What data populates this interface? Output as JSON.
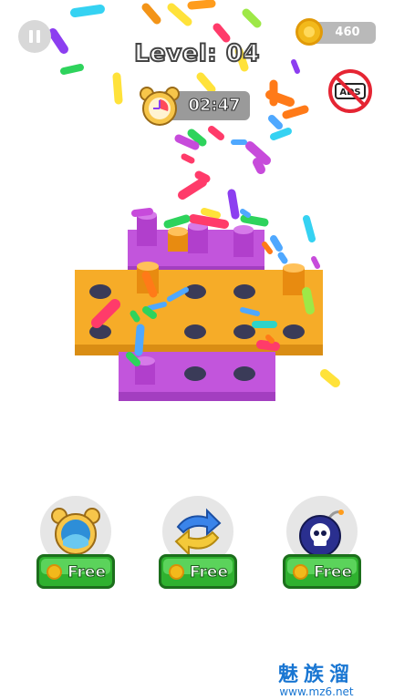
{
  "hud": {
    "coins": "460",
    "level_label": "Level: 04",
    "timer": "02:47",
    "ads_label": "ADS"
  },
  "boosters": [
    {
      "icon": "alarm-clock-icon",
      "label": "Free"
    },
    {
      "icon": "swap-arrows-icon",
      "label": "Free"
    },
    {
      "icon": "skull-bomb-icon",
      "label": "Free"
    }
  ],
  "watermark": {
    "brand": "魅族溜",
    "url": "www.mz6.net"
  },
  "colors": {
    "orange_tile": "#f6ac28",
    "purple_tile": "#c255dc",
    "green_button": "#2fb12f",
    "coin_gold": "#f2b91b"
  }
}
